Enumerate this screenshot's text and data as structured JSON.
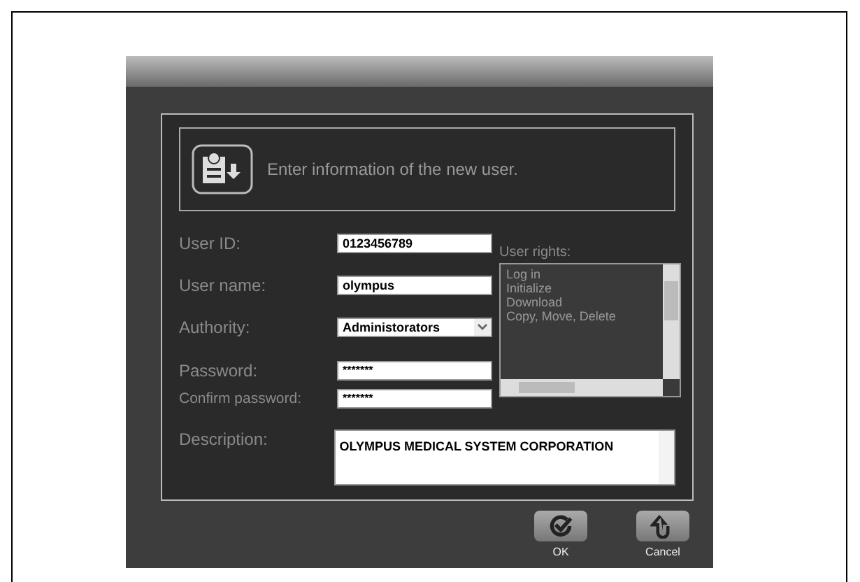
{
  "header": {
    "message": "Enter information of the new user."
  },
  "fields": [
    {
      "kind": "text",
      "label": "User ID:",
      "value": "0123456789"
    },
    {
      "kind": "text",
      "label": "User name:",
      "value": "olympus"
    },
    {
      "kind": "select",
      "label": "Authority:",
      "value": "Administorators"
    },
    {
      "kind": "password",
      "label": "Password:",
      "value": "*******"
    },
    {
      "kind": "password",
      "label": "Confirm password:",
      "value": "*******"
    }
  ],
  "user_rights": {
    "label": "User rights:",
    "items": [
      "Log in",
      "Initialize",
      "Download",
      "Copy, Move, Delete"
    ]
  },
  "description": {
    "label": "Description:",
    "value": "OLYMPUS MEDICAL SYSTEM CORPORATION"
  },
  "buttons": [
    {
      "kind": "ok",
      "label": "OK"
    },
    {
      "kind": "cancel",
      "label": "Cancel"
    }
  ]
}
